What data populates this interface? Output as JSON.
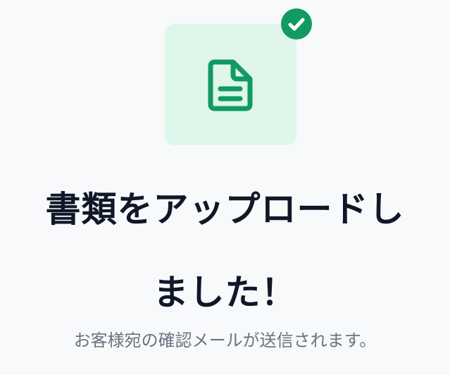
{
  "illustration": {
    "icon": "document-icon",
    "badge_icon": "check-icon",
    "tile_color": "#def7ea",
    "accent_color": "#129a63"
  },
  "heading": {
    "line1": "書類をアップロードし",
    "line2": "ました！"
  },
  "message": "お客様宛の確認メールが送信されます。"
}
